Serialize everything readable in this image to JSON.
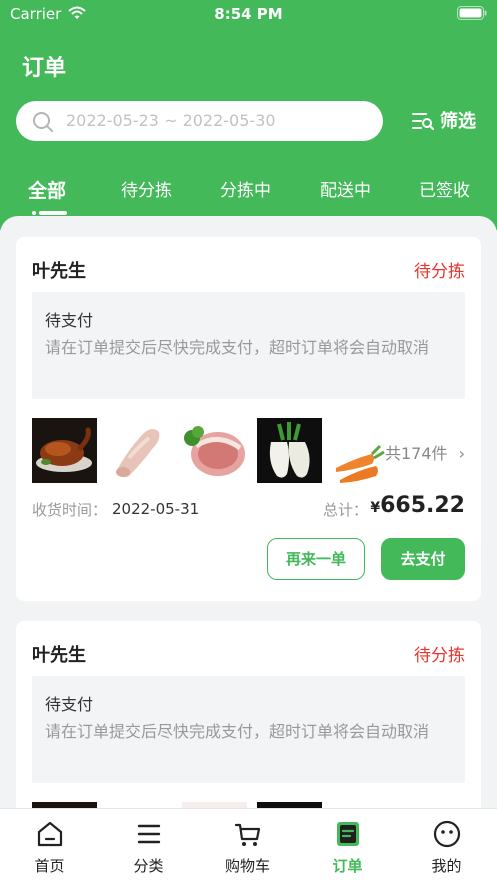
{
  "status_bar": {
    "carrier": "Carrier",
    "time": "8:54 PM"
  },
  "page": {
    "title": "订单"
  },
  "search": {
    "date_range": "2022-05-23 ~ 2022-05-30"
  },
  "filter": {
    "label": "筛选"
  },
  "tabs": [
    {
      "label": "全部",
      "active": true
    },
    {
      "label": "待分拣"
    },
    {
      "label": "分拣中"
    },
    {
      "label": "配送中"
    },
    {
      "label": "已签收"
    }
  ],
  "orders": [
    {
      "customer": "叶先生",
      "status": "待分拣",
      "notice_title": "待支付",
      "notice_text": "请在订单提交后尽快完成支付，超时订单将会自动取消",
      "item_count": "共174件",
      "delivery_label": "收货时间：",
      "delivery_date": "2022-05-31",
      "total_label": "总计：",
      "currency": "¥",
      "total": "665.22",
      "reorder_label": "再来一单",
      "pay_label": "去支付"
    },
    {
      "customer": "叶先生",
      "status": "待分拣",
      "notice_title": "待支付",
      "notice_text": "请在订单提交后尽快完成支付，超时订单将会自动取消"
    }
  ],
  "bottom_nav": [
    {
      "label": "首页",
      "icon": "home-icon"
    },
    {
      "label": "分类",
      "icon": "list-icon"
    },
    {
      "label": "购物车",
      "icon": "cart-icon"
    },
    {
      "label": "订单",
      "icon": "order-icon",
      "active": true
    },
    {
      "label": "我的",
      "icon": "profile-icon"
    }
  ],
  "colors": {
    "brand": "#44b95a",
    "status_red": "#e8352e",
    "background": "#f2f3f5"
  }
}
